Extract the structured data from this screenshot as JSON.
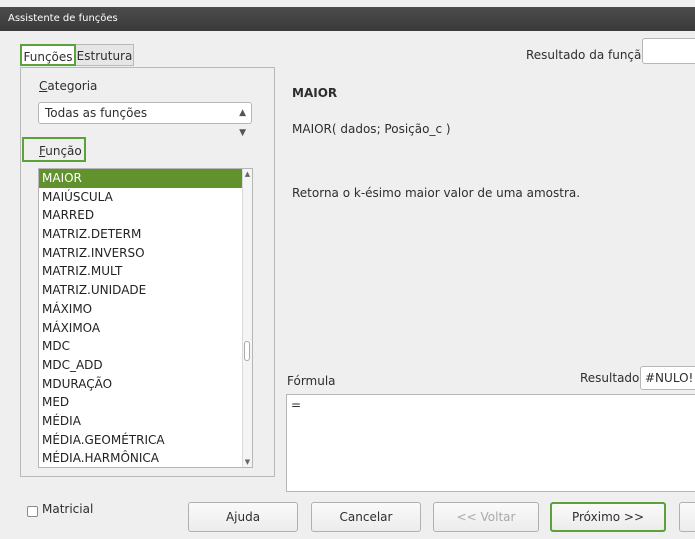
{
  "window": {
    "title": "Assistente de funções"
  },
  "tabs": [
    {
      "label": "Funções"
    },
    {
      "label": "Estrutura"
    }
  ],
  "result": {
    "label": "Resultado da função",
    "value": ""
  },
  "category": {
    "label": "Categoria",
    "selected": "Todas as funções"
  },
  "function_list": {
    "label": "Função",
    "items": [
      "MAIOR",
      "MAIÚSCULA",
      "MARRED",
      "MATRIZ.DETERM",
      "MATRIZ.INVERSO",
      "MATRIZ.MULT",
      "MATRIZ.UNIDADE",
      "MÁXIMO",
      "MÁXIMOA",
      "MDC",
      "MDC_ADD",
      "MDURAÇÃO",
      "MED",
      "MÉDIA",
      "MÉDIA.GEOMÉTRICA",
      "MÉDIA.HARMÔNICA"
    ],
    "selected_index": 0
  },
  "details": {
    "name": "MAIOR",
    "syntax": "MAIOR( dados; Posição_c )",
    "description": "Retorna o k-ésimo maior valor de uma amostra."
  },
  "formula": {
    "label": "Fórmula",
    "value": "=",
    "result_label": "Resultado",
    "result_value": "#NULO!"
  },
  "footer": {
    "matricial_label": "Matricial",
    "buttons": {
      "help": "Ajuda",
      "cancel": "Cancelar",
      "back": "<< Voltar",
      "next": "Próximo >>"
    }
  },
  "colors": {
    "highlight": "#5ca23a",
    "selection": "#61922e",
    "titlebar": "#3d3d3d"
  }
}
